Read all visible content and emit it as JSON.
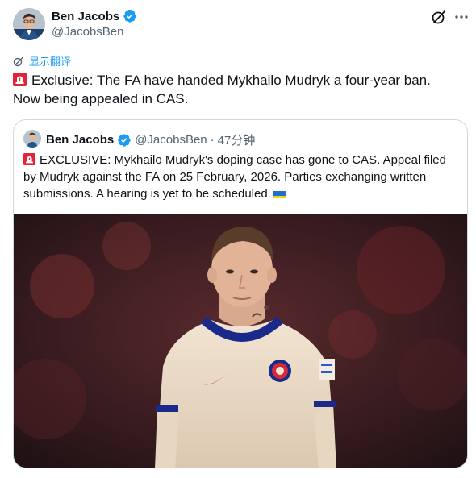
{
  "tweet": {
    "author": {
      "name": "Ben Jacobs",
      "handle": "@JacobsBen"
    },
    "translate_label": "显示翻译",
    "text_line1": "Exclusive: The FA have handed Mykhailo Mudryk a four-year ban.",
    "text_line2": "Now being appealed in CAS."
  },
  "quote": {
    "author": {
      "name": "Ben Jacobs",
      "handle": "@JacobsBen",
      "separator": "·",
      "time": "47分钟"
    },
    "text": "EXCLUSIVE: Mykhailo Mudryk's doping case has gone to CAS. Appeal filed by Mudryk against the FA on 25 February, 2026. Parties exchanging written submissions. A hearing is yet to be scheduled."
  },
  "colors": {
    "accent": "#1d9bf0",
    "text_primary": "#0f1419",
    "text_secondary": "#536471",
    "border": "#cfd9de"
  },
  "icons": {
    "verified": "verified-badge-icon",
    "grok": "grok-icon",
    "more": "more-horizontal-icon",
    "translate": "translate-icon",
    "siren_emoji": "rotating-light-emoji",
    "flag_emoji": "ukraine-flag-emoji"
  }
}
